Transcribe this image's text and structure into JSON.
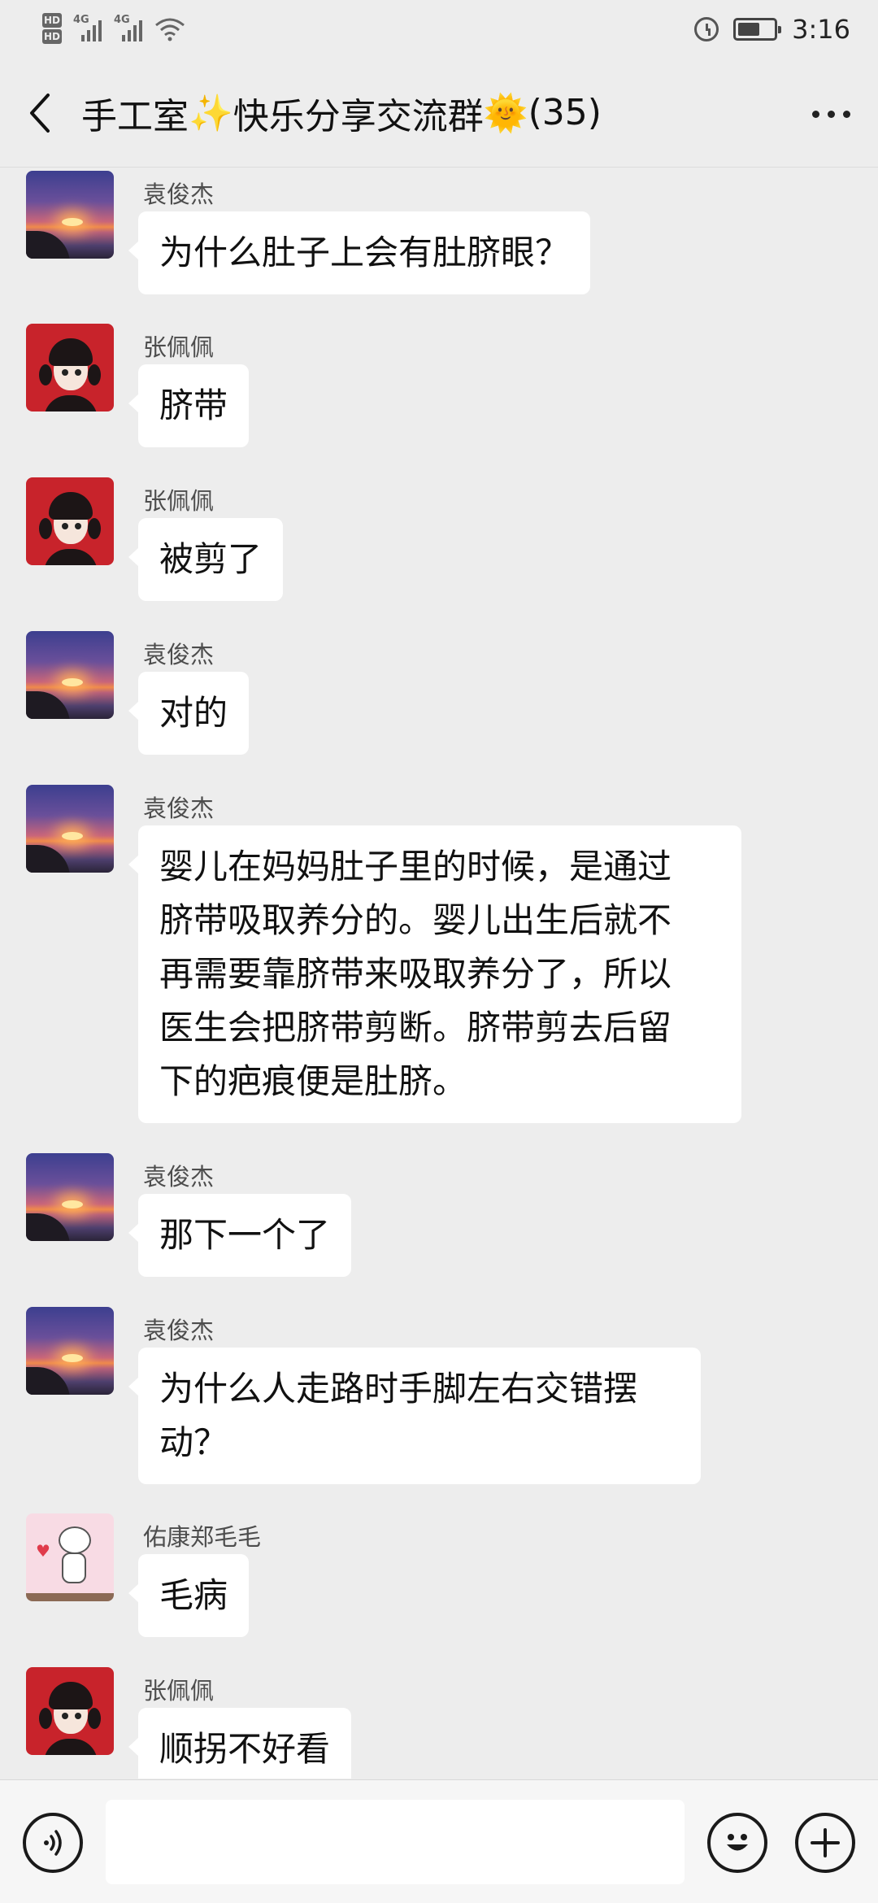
{
  "status_bar": {
    "hd1": "HD",
    "hd2": "HD",
    "sim1": "4G",
    "sim2": "4G",
    "time": "3:16",
    "icons": [
      "signal-icon",
      "wifi-icon",
      "alarm-icon",
      "battery-icon"
    ]
  },
  "header": {
    "title_part1": "手工室",
    "title_emoji1": "✨",
    "title_part2": " 快乐分享交流群",
    "title_emoji2": "🌞",
    "title_count": "(35)",
    "back_icon": "chevron-left-icon",
    "more_icon": "more-dots-icon"
  },
  "messages": [
    {
      "sender": "袁俊杰",
      "avatar": "sunset",
      "text": "为什么肚子上会有肚脐眼？"
    },
    {
      "sender": "张佩佩",
      "avatar": "girl",
      "text": "脐带"
    },
    {
      "sender": "张佩佩",
      "avatar": "girl",
      "text": "被剪了"
    },
    {
      "sender": "袁俊杰",
      "avatar": "sunset",
      "text": "对的"
    },
    {
      "sender": "袁俊杰",
      "avatar": "sunset",
      "lines": [
        "婴儿在妈妈肚子里的时候，是通过",
        "脐带吸取养分的。婴儿出生后就不",
        "再需要靠脐带来吸取养分了，所以",
        "医生会把脐带剪断。脐带剪去后留",
        "下的疤痕便是肚脐。"
      ]
    },
    {
      "sender": "袁俊杰",
      "avatar": "sunset",
      "text": "那下一个了"
    },
    {
      "sender": "袁俊杰",
      "avatar": "sunset",
      "lines": [
        "为什么人走路时手脚左右交错摆",
        "动？"
      ]
    },
    {
      "sender": "佑康郑毛毛",
      "avatar": "cartoon",
      "text": "毛病"
    },
    {
      "sender": "张佩佩",
      "avatar": "girl",
      "text": "顺拐不好看"
    }
  ],
  "input_bar": {
    "text_value": "",
    "voice_icon": "voice-icon",
    "emoji_icon": "emoji-icon",
    "plus_icon": "plus-icon"
  }
}
